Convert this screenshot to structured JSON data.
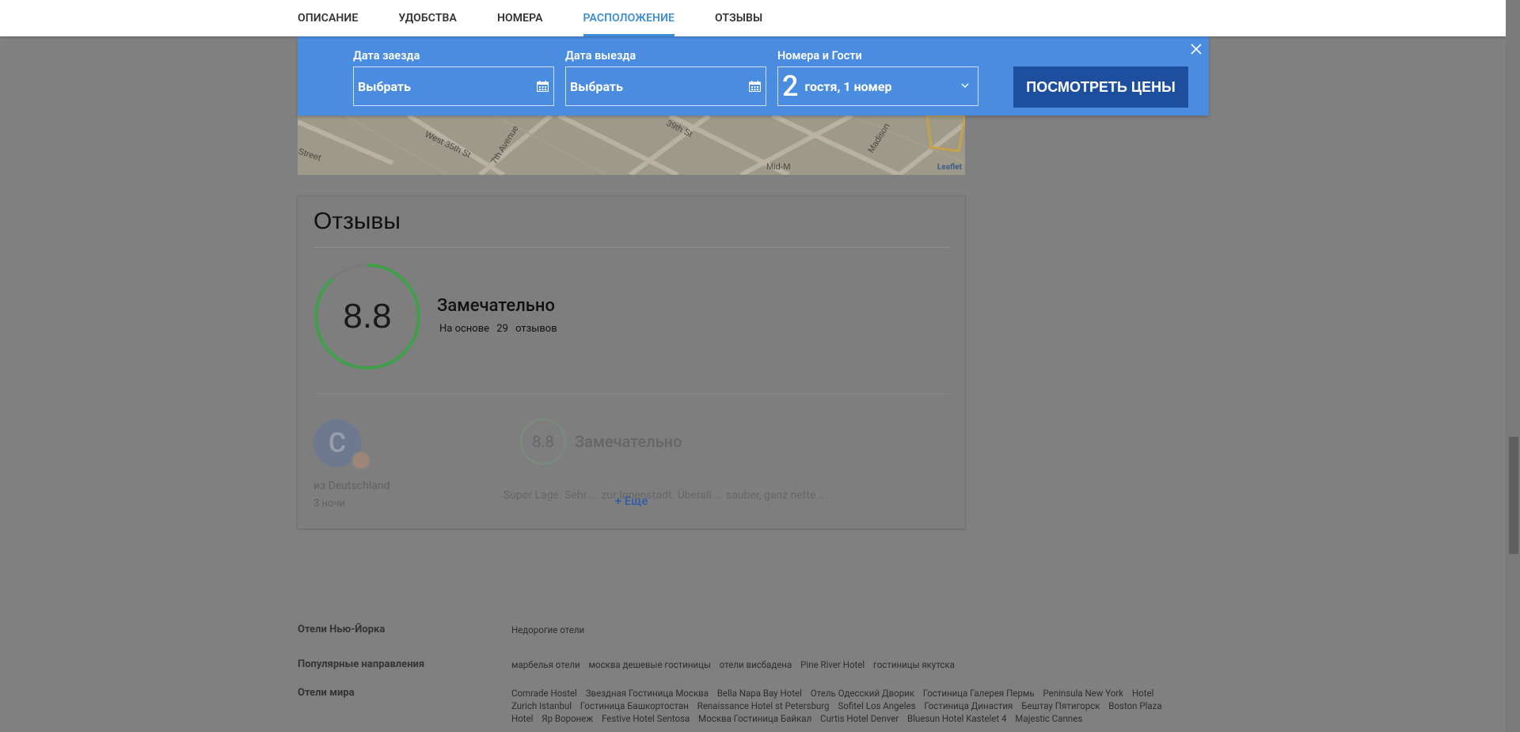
{
  "nav": {
    "tabs": [
      {
        "label": "ОПИСАНИЕ"
      },
      {
        "label": "УДОБСТВА"
      },
      {
        "label": "НОМЕРА"
      },
      {
        "label": "РАСПОЛОЖЕНИЕ",
        "active": true
      },
      {
        "label": "ОТЗЫВЫ"
      }
    ]
  },
  "booking": {
    "checkin_label": "Дата заезда",
    "checkin_value": "Выбрать",
    "checkout_label": "Дата выезда",
    "checkout_value": "Выбрать",
    "guests_label": "Номера и Гости",
    "guests_count": "2",
    "guests_text": "гостя, 1 номер",
    "cta": "ПОСМОТРЕТЬ ЦЕНЫ",
    "accent": "#4a8de0",
    "cta_color": "#1e4f9e"
  },
  "map": {
    "streets": [
      "Street",
      "West 35th St",
      "7th Avenue",
      "39th St",
      "Madison",
      "Mid-M"
    ],
    "attribution": "Leaflet"
  },
  "reviews": {
    "title": "Отзывы",
    "score": "8.8",
    "score_fraction": 0.88,
    "verdict": "Замечательно",
    "basis_prefix": "На основе",
    "count": "29",
    "basis_suffix": "отзывов",
    "ring_color": "#3fa04a",
    "item": {
      "initial": "C",
      "from": "из Deutschland",
      "days": "3 ночи",
      "score": "8.8",
      "verdict": "Замечательно",
      "snippet": "Super Lage. Sehr ... zur Innenstadt. Überall ... sauber, ganz nette ..."
    },
    "more": "+ Еще"
  },
  "footer": {
    "rows": [
      {
        "heading": "Отели Нью-Йорка",
        "links": [
          "Недорогие отели"
        ]
      },
      {
        "heading": "Популярные направления",
        "links": [
          "марбелья отели",
          "москва дешевые гостиницы",
          "отели висбадена",
          "Pine River Hotel",
          "гостиницы якутска"
        ]
      },
      {
        "heading": "Отели мира",
        "links": [
          "Comrade Hostel",
          "Звездная Гостиница Москва",
          "Bella Napa Bay Hotel",
          "Отель Одесский Дворик",
          "Гостиница Галерея Пермь",
          "Peninsula New York",
          "Hotel Zurich Istanbul",
          "Гостиница Башкортостан",
          "Renaissance Hotel st Petersburg",
          "Sofitel Los Angeles",
          "Гостиница Династия",
          "Бештау Пятигорск",
          "Boston Plaza Hotel",
          "Яр Воронеж",
          "Festive Hotel Sentosa",
          "Москва Гостиница Байкал",
          "Curtis Hotel Denver",
          "Bluesun Hotel Kastelet 4",
          "Majestic Cannes"
        ]
      }
    ]
  }
}
